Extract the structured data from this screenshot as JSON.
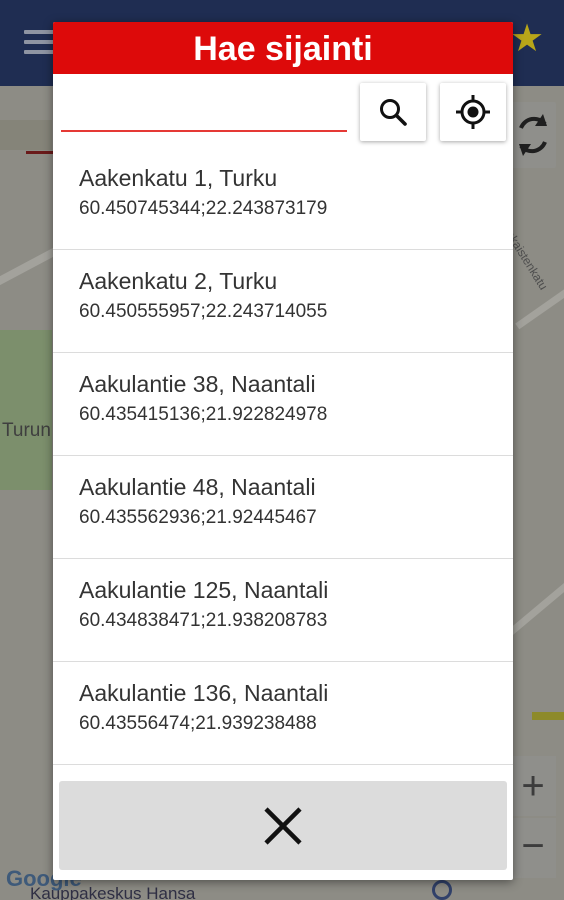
{
  "map": {
    "label_left": "Turun",
    "label_street": "Aurakaistenkatu",
    "label_bottom": "Kauppakeskus Hansa",
    "google_logo": "Google",
    "refresh_icon": "refresh-icon",
    "zoom_in": "+",
    "zoom_out": "−"
  },
  "dialog": {
    "title": "Hae sijainti",
    "search": {
      "value": "",
      "placeholder": ""
    },
    "search_button_icon": "search-icon",
    "locate_button_icon": "gps-locate-icon",
    "close_icon": "close-icon"
  },
  "results": [
    {
      "name": "Aakenkatu 1, Turku",
      "coords": "60.450745344;22.243873179"
    },
    {
      "name": "Aakenkatu 2, Turku",
      "coords": "60.450555957;22.243714055"
    },
    {
      "name": "Aakulantie 38, Naantali",
      "coords": "60.435415136;21.922824978"
    },
    {
      "name": "Aakulantie 48, Naantali",
      "coords": "60.435562936;21.92445467"
    },
    {
      "name": "Aakulantie 125, Naantali",
      "coords": "60.434838471;21.938208783"
    },
    {
      "name": "Aakulantie 136, Naantali",
      "coords": "60.43556474;21.939238488"
    }
  ],
  "colors": {
    "header_red": "#dd0a0a",
    "input_underline": "#e53935",
    "close_button_bg": "#dcdcdc",
    "topbar_navy": "#1f2d52"
  }
}
